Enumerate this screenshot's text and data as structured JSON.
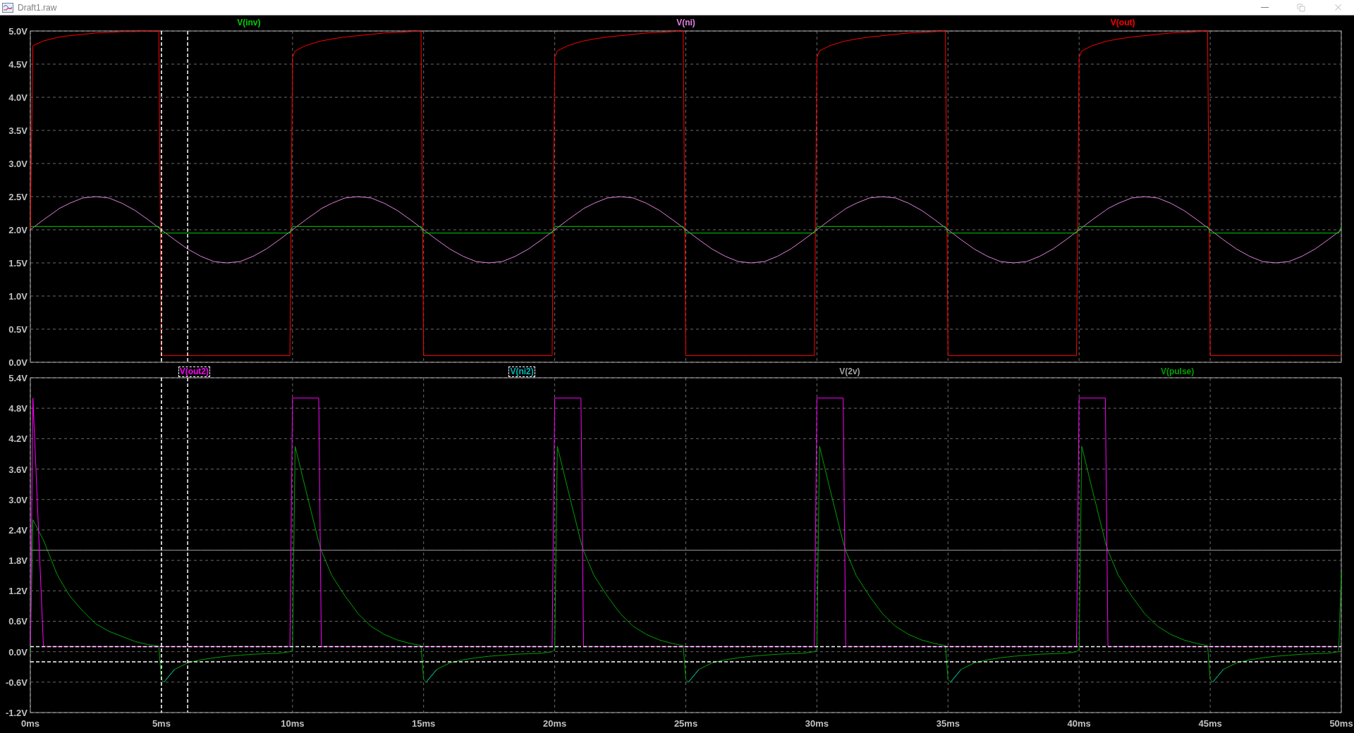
{
  "window": {
    "title": "Draft1.raw"
  },
  "top_pane": {
    "trace_labels": [
      {
        "cursor": false
      },
      {
        "cursor": false
      },
      {
        "cursor": false
      }
    ],
    "chart_data": {
      "type": "line",
      "grid": true,
      "xlim": [
        0,
        50
      ],
      "ylim": [
        0,
        5
      ],
      "x": [
        0,
        0.1,
        0.5,
        1,
        1.1,
        1.5,
        2,
        2.5,
        3,
        3.5,
        4,
        4.5,
        4.9,
        5,
        5.1,
        5.5,
        6,
        6.5,
        7,
        7.5,
        8,
        8.5,
        9,
        9.5,
        9.9,
        10,
        10.1,
        10.5,
        11,
        11.1,
        11.5,
        12,
        12.5,
        13,
        13.5,
        14,
        14.5,
        14.9,
        15,
        15.1,
        15.5,
        16,
        16.5,
        17,
        17.5,
        18,
        18.5,
        19,
        19.5,
        19.9,
        20,
        20.1,
        20.5,
        21,
        21.1,
        21.5,
        22,
        22.5,
        23,
        23.5,
        24,
        24.5,
        24.9,
        25,
        25.1,
        25.5,
        26,
        26.5,
        27,
        27.5,
        28,
        28.5,
        29,
        29.5,
        29.9,
        30,
        30.1,
        30.5,
        31,
        31.1,
        31.5,
        32,
        32.5,
        33,
        33.5,
        34,
        34.5,
        34.9,
        35,
        35.1,
        35.5,
        36,
        36.5,
        37,
        37.5,
        38,
        38.5,
        39,
        39.5,
        39.9,
        40,
        40.1,
        40.5,
        41,
        41.1,
        41.5,
        42,
        42.5,
        43,
        43.5,
        44,
        44.5,
        44.9,
        45,
        45.1,
        45.5,
        46,
        46.5,
        47,
        47.5,
        48,
        48.5,
        49,
        49.5,
        49.9,
        50
      ],
      "series": [
        {
          "name": "V(inv)",
          "color": "#00d000",
          "values": [
            2.05,
            2.05,
            2.05,
            2.05,
            2.05,
            2.05,
            2.05,
            2.05,
            2.05,
            2.05,
            2.05,
            2.05,
            2.05,
            1.95,
            1.95,
            1.95,
            1.95,
            1.95,
            1.95,
            1.95,
            1.95,
            1.95,
            1.95,
            1.95,
            1.95,
            2.05,
            2.05,
            2.05,
            2.05,
            2.05,
            2.05,
            2.05,
            2.05,
            2.05,
            2.05,
            2.05,
            2.05,
            2.05,
            1.95,
            1.95,
            1.95,
            1.95,
            1.95,
            1.95,
            1.95,
            1.95,
            1.95,
            1.95,
            1.95,
            1.95,
            2.05,
            2.05,
            2.05,
            2.05,
            2.05,
            2.05,
            2.05,
            2.05,
            2.05,
            2.05,
            2.05,
            2.05,
            2.05,
            1.95,
            1.95,
            1.95,
            1.95,
            1.95,
            1.95,
            1.95,
            1.95,
            1.95,
            1.95,
            1.95,
            1.95,
            2.05,
            2.05,
            2.05,
            2.05,
            2.05,
            2.05,
            2.05,
            2.05,
            2.05,
            2.05,
            2.05,
            2.05,
            2.05,
            1.95,
            1.95,
            1.95,
            1.95,
            1.95,
            1.95,
            1.95,
            1.95,
            1.95,
            1.95,
            1.95,
            1.95,
            2.05,
            2.05,
            2.05,
            2.05,
            2.05,
            2.05,
            2.05,
            2.05,
            2.05,
            2.05,
            2.05,
            2.05,
            2.05,
            1.95,
            1.95,
            1.95,
            1.95,
            1.95,
            1.95,
            1.95,
            1.95,
            1.95,
            1.95,
            1.95,
            1.95,
            2.05
          ]
        },
        {
          "name": "V(ni)",
          "color": "#e080e0",
          "values": [
            2.0,
            2.03,
            2.15,
            2.29,
            2.32,
            2.4,
            2.48,
            2.5,
            2.48,
            2.4,
            2.29,
            2.15,
            2.03,
            2.0,
            1.97,
            1.85,
            1.71,
            1.6,
            1.52,
            1.5,
            1.52,
            1.6,
            1.71,
            1.85,
            1.97,
            2.0,
            2.03,
            2.15,
            2.29,
            2.32,
            2.4,
            2.48,
            2.5,
            2.48,
            2.4,
            2.29,
            2.15,
            2.03,
            2.0,
            1.97,
            1.85,
            1.71,
            1.6,
            1.52,
            1.5,
            1.52,
            1.6,
            1.71,
            1.85,
            1.97,
            2.0,
            2.03,
            2.15,
            2.29,
            2.32,
            2.4,
            2.48,
            2.5,
            2.48,
            2.4,
            2.29,
            2.15,
            2.03,
            2.0,
            1.97,
            1.85,
            1.71,
            1.6,
            1.52,
            1.5,
            1.52,
            1.6,
            1.71,
            1.85,
            1.97,
            2.0,
            2.03,
            2.15,
            2.29,
            2.32,
            2.4,
            2.48,
            2.5,
            2.48,
            2.4,
            2.29,
            2.15,
            2.03,
            2.0,
            1.97,
            1.85,
            1.71,
            1.6,
            1.52,
            1.5,
            1.52,
            1.6,
            1.71,
            1.85,
            1.97,
            2.0,
            2.03,
            2.15,
            2.29,
            2.32,
            2.4,
            2.48,
            2.5,
            2.48,
            2.4,
            2.29,
            2.15,
            2.03,
            2.0,
            1.97,
            1.85,
            1.71,
            1.6,
            1.52,
            1.5,
            1.52,
            1.6,
            1.71,
            1.85,
            1.97,
            2.0
          ]
        },
        {
          "name": "V(out)",
          "color": "#ff0000",
          "values": [
            2.0,
            4.78,
            4.85,
            4.9,
            4.91,
            4.93,
            4.95,
            4.97,
            4.98,
            4.99,
            4.99,
            5.0,
            5.0,
            0.1,
            0.1,
            0.1,
            0.1,
            0.1,
            0.1,
            0.1,
            0.1,
            0.1,
            0.1,
            0.1,
            0.1,
            4.6,
            4.7,
            4.78,
            4.84,
            4.85,
            4.88,
            4.91,
            4.93,
            4.95,
            4.97,
            4.98,
            4.99,
            5.0,
            0.1,
            0.1,
            0.1,
            0.1,
            0.1,
            0.1,
            0.1,
            0.1,
            0.1,
            0.1,
            0.1,
            0.1,
            4.6,
            4.7,
            4.78,
            4.84,
            4.85,
            4.88,
            4.91,
            4.93,
            4.95,
            4.97,
            4.98,
            4.99,
            5.0,
            0.1,
            0.1,
            0.1,
            0.1,
            0.1,
            0.1,
            0.1,
            0.1,
            0.1,
            0.1,
            0.1,
            0.1,
            4.6,
            4.7,
            4.78,
            4.84,
            4.85,
            4.88,
            4.91,
            4.93,
            4.95,
            4.97,
            4.98,
            4.99,
            5.0,
            0.1,
            0.1,
            0.1,
            0.1,
            0.1,
            0.1,
            0.1,
            0.1,
            0.1,
            0.1,
            0.1,
            0.1,
            4.6,
            4.7,
            4.78,
            4.84,
            4.85,
            4.88,
            4.91,
            4.93,
            4.95,
            4.97,
            4.98,
            4.99,
            5.0,
            0.1,
            0.1,
            0.1,
            0.1,
            0.1,
            0.1,
            0.1,
            0.1,
            0.1,
            0.1,
            0.1,
            0.1,
            0.1
          ]
        }
      ],
      "yticks": [
        {
          "value": 0,
          "label": "0.0V"
        },
        {
          "value": 0.5,
          "label": "0.5V"
        },
        {
          "value": 1,
          "label": "1.0V"
        },
        {
          "value": 1.5,
          "label": "1.5V"
        },
        {
          "value": 2,
          "label": "2.0V"
        },
        {
          "value": 2.5,
          "label": "2.5V"
        },
        {
          "value": 3,
          "label": "3.0V"
        },
        {
          "value": 3.5,
          "label": "3.5V"
        },
        {
          "value": 4,
          "label": "4.0V"
        },
        {
          "value": 4.5,
          "label": "4.5V"
        },
        {
          "value": 5,
          "label": "5.0V"
        }
      ],
      "ref_lines": [
        {
          "axis": "x",
          "value": 5
        },
        {
          "axis": "x",
          "value": 6
        }
      ]
    }
  },
  "bottom_pane": {
    "trace_labels": [
      {
        "cursor": true
      },
      {
        "cursor": true
      },
      {
        "cursor": false
      },
      {
        "cursor": false
      }
    ],
    "chart_data": {
      "type": "line",
      "grid": true,
      "xlim": [
        0,
        50
      ],
      "ylim": [
        -1.2,
        5.4
      ],
      "x": [
        0,
        0.1,
        0.5,
        1,
        1.1,
        1.5,
        2,
        2.5,
        3,
        3.5,
        4,
        4.5,
        4.9,
        5,
        5.1,
        5.5,
        6,
        6.5,
        7,
        7.5,
        8,
        8.5,
        9,
        9.5,
        9.9,
        10,
        10.1,
        10.5,
        11,
        11.1,
        11.5,
        12,
        12.5,
        13,
        13.5,
        14,
        14.5,
        14.9,
        15,
        15.1,
        15.5,
        16,
        16.5,
        17,
        17.5,
        18,
        18.5,
        19,
        19.5,
        19.9,
        20,
        20.1,
        20.5,
        21,
        21.1,
        21.5,
        22,
        22.5,
        23,
        23.5,
        24,
        24.5,
        24.9,
        25,
        25.1,
        25.5,
        26,
        26.5,
        27,
        27.5,
        28,
        28.5,
        29,
        29.5,
        29.9,
        30,
        30.1,
        30.5,
        31,
        31.1,
        31.5,
        32,
        32.5,
        33,
        33.5,
        34,
        34.5,
        34.9,
        35,
        35.1,
        35.5,
        36,
        36.5,
        37,
        37.5,
        38,
        38.5,
        39,
        39.5,
        39.9,
        40,
        40.1,
        40.5,
        41,
        41.1,
        41.5,
        42,
        42.5,
        43,
        43.5,
        44,
        44.5,
        44.9,
        45,
        45.1,
        45.5,
        46,
        46.5,
        47,
        47.5,
        48,
        48.5,
        49,
        49.5,
        49.9,
        50
      ],
      "series": [
        {
          "name": "V(out2)",
          "color": "#ff00ff",
          "values": [
            0.1,
            5.0,
            0.1,
            0.1,
            0.1,
            0.1,
            0.1,
            0.1,
            0.1,
            0.1,
            0.1,
            0.1,
            0.1,
            0.1,
            0.1,
            0.1,
            0.1,
            0.1,
            0.1,
            0.1,
            0.1,
            0.1,
            0.1,
            0.1,
            0.1,
            5.0,
            5.0,
            5.0,
            5.0,
            0.1,
            0.1,
            0.1,
            0.1,
            0.1,
            0.1,
            0.1,
            0.1,
            0.1,
            0.1,
            0.1,
            0.1,
            0.1,
            0.1,
            0.1,
            0.1,
            0.1,
            0.1,
            0.1,
            0.1,
            0.1,
            5.0,
            5.0,
            5.0,
            5.0,
            0.1,
            0.1,
            0.1,
            0.1,
            0.1,
            0.1,
            0.1,
            0.1,
            0.1,
            0.1,
            0.1,
            0.1,
            0.1,
            0.1,
            0.1,
            0.1,
            0.1,
            0.1,
            0.1,
            0.1,
            0.1,
            5.0,
            5.0,
            5.0,
            5.0,
            0.1,
            0.1,
            0.1,
            0.1,
            0.1,
            0.1,
            0.1,
            0.1,
            0.1,
            0.1,
            0.1,
            0.1,
            0.1,
            0.1,
            0.1,
            0.1,
            0.1,
            0.1,
            0.1,
            0.1,
            0.1,
            5.0,
            5.0,
            5.0,
            5.0,
            0.1,
            0.1,
            0.1,
            0.1,
            0.1,
            0.1,
            0.1,
            0.1,
            0.1,
            0.1,
            0.1,
            0.1,
            0.1,
            0.1,
            0.1,
            0.1,
            0.1,
            0.1,
            0.1,
            0.1,
            0.1,
            0.1
          ]
        },
        {
          "name": "V(ni2)",
          "color": "#00b8b8",
          "values": [
            null,
            null,
            null,
            null,
            null,
            null,
            null,
            null,
            null,
            null,
            null,
            null,
            null,
            null,
            -0.6,
            -0.35,
            null,
            null,
            null,
            null,
            null,
            null,
            null,
            null,
            null,
            null,
            null,
            null,
            null,
            null,
            null,
            null,
            null,
            null,
            null,
            null,
            null,
            null,
            null,
            -0.6,
            -0.35,
            null,
            null,
            null,
            null,
            null,
            null,
            null,
            null,
            null,
            null,
            null,
            null,
            null,
            null,
            null,
            null,
            null,
            null,
            null,
            null,
            null,
            null,
            null,
            -0.6,
            -0.35,
            null,
            null,
            null,
            null,
            null,
            null,
            null,
            null,
            null,
            null,
            null,
            null,
            null,
            null,
            null,
            null,
            null,
            null,
            null,
            null,
            null,
            null,
            null,
            -0.6,
            -0.35,
            null,
            null,
            null,
            null,
            null,
            null,
            null,
            null,
            null,
            null,
            null,
            null,
            null,
            null,
            null,
            null,
            null,
            null,
            null,
            null,
            null,
            null,
            null,
            -0.6,
            -0.35,
            null,
            null,
            null,
            null,
            null,
            null,
            null,
            null,
            null,
            null
          ]
        },
        {
          "name": "V(2v)",
          "color": "#a0a0a0",
          "values": [
            2,
            2,
            2,
            2,
            2,
            2,
            2,
            2,
            2,
            2,
            2,
            2,
            2,
            2,
            2,
            2,
            2,
            2,
            2,
            2,
            2,
            2,
            2,
            2,
            2,
            2,
            2,
            2,
            2,
            2,
            2,
            2,
            2,
            2,
            2,
            2,
            2,
            2,
            2,
            2,
            2,
            2,
            2,
            2,
            2,
            2,
            2,
            2,
            2,
            2,
            2,
            2,
            2,
            2,
            2,
            2,
            2,
            2,
            2,
            2,
            2,
            2,
            2,
            2,
            2,
            2,
            2,
            2,
            2,
            2,
            2,
            2,
            2,
            2,
            2,
            2,
            2,
            2,
            2,
            2,
            2,
            2,
            2,
            2,
            2,
            2,
            2,
            2,
            2,
            2,
            2,
            2,
            2,
            2,
            2,
            2,
            2,
            2,
            2,
            2,
            2,
            2,
            2,
            2,
            2,
            2,
            2,
            2,
            2,
            2,
            2,
            2,
            2,
            2,
            2,
            2,
            2,
            2,
            2,
            2,
            2,
            2,
            2,
            2,
            2,
            2
          ]
        },
        {
          "name": "V(pulse)",
          "color": "#00a000",
          "values": [
            0.0,
            2.6,
            2.2,
            1.55,
            1.45,
            1.1,
            0.8,
            0.55,
            0.4,
            0.3,
            0.2,
            0.14,
            0.11,
            -0.55,
            -0.6,
            -0.35,
            -0.22,
            -0.16,
            -0.12,
            -0.09,
            -0.07,
            -0.05,
            -0.04,
            -0.03,
            0.0,
            0.05,
            4.05,
            3.2,
            2.16,
            1.99,
            1.5,
            1.1,
            0.75,
            0.5,
            0.34,
            0.23,
            0.16,
            0.12,
            -0.55,
            -0.6,
            -0.35,
            -0.22,
            -0.16,
            -0.12,
            -0.09,
            -0.07,
            -0.05,
            -0.04,
            -0.03,
            0.0,
            0.05,
            4.05,
            3.2,
            2.16,
            1.99,
            1.5,
            1.1,
            0.75,
            0.5,
            0.34,
            0.23,
            0.16,
            0.12,
            -0.55,
            -0.6,
            -0.35,
            -0.22,
            -0.16,
            -0.12,
            -0.09,
            -0.07,
            -0.05,
            -0.04,
            -0.03,
            0.0,
            0.05,
            4.05,
            3.2,
            2.16,
            1.99,
            1.5,
            1.1,
            0.75,
            0.5,
            0.34,
            0.23,
            0.16,
            0.12,
            -0.55,
            -0.6,
            -0.35,
            -0.22,
            -0.16,
            -0.12,
            -0.09,
            -0.07,
            -0.05,
            -0.04,
            -0.03,
            0.0,
            0.05,
            4.05,
            3.2,
            2.16,
            1.99,
            1.5,
            1.1,
            0.75,
            0.5,
            0.34,
            0.23,
            0.16,
            0.12,
            -0.55,
            -0.6,
            -0.35,
            -0.22,
            -0.16,
            -0.12,
            -0.09,
            -0.07,
            -0.05,
            -0.04,
            -0.03,
            0.0,
            1.6
          ]
        }
      ],
      "xticks": [
        {
          "value": 0,
          "label": "0ms"
        },
        {
          "value": 5,
          "label": "5ms"
        },
        {
          "value": 10,
          "label": "10ms"
        },
        {
          "value": 15,
          "label": "15ms"
        },
        {
          "value": 20,
          "label": "20ms"
        },
        {
          "value": 25,
          "label": "25ms"
        },
        {
          "value": 30,
          "label": "30ms"
        },
        {
          "value": 35,
          "label": "35ms"
        },
        {
          "value": 40,
          "label": "40ms"
        },
        {
          "value": 45,
          "label": "45ms"
        },
        {
          "value": 50,
          "label": "50ms"
        }
      ],
      "yticks": [
        {
          "value": -1.2,
          "label": "-1.2V"
        },
        {
          "value": -0.6,
          "label": "-0.6V"
        },
        {
          "value": 0,
          "label": "0.0V"
        },
        {
          "value": 0.6,
          "label": "0.6V"
        },
        {
          "value": 1.2,
          "label": "1.2V"
        },
        {
          "value": 1.8,
          "label": "1.8V"
        },
        {
          "value": 2.4,
          "label": "2.4V"
        },
        {
          "value": 3,
          "label": "3.0V"
        },
        {
          "value": 3.6,
          "label": "3.6V"
        },
        {
          "value": 4.2,
          "label": "4.2V"
        },
        {
          "value": 4.8,
          "label": "4.8V"
        },
        {
          "value": 5.4,
          "label": "5.4V"
        }
      ],
      "ref_lines": [
        {
          "axis": "x",
          "value": 5
        },
        {
          "axis": "x",
          "value": 6
        },
        {
          "axis": "y",
          "value": 0.1
        },
        {
          "axis": "y",
          "value": -0.2
        }
      ]
    }
  }
}
